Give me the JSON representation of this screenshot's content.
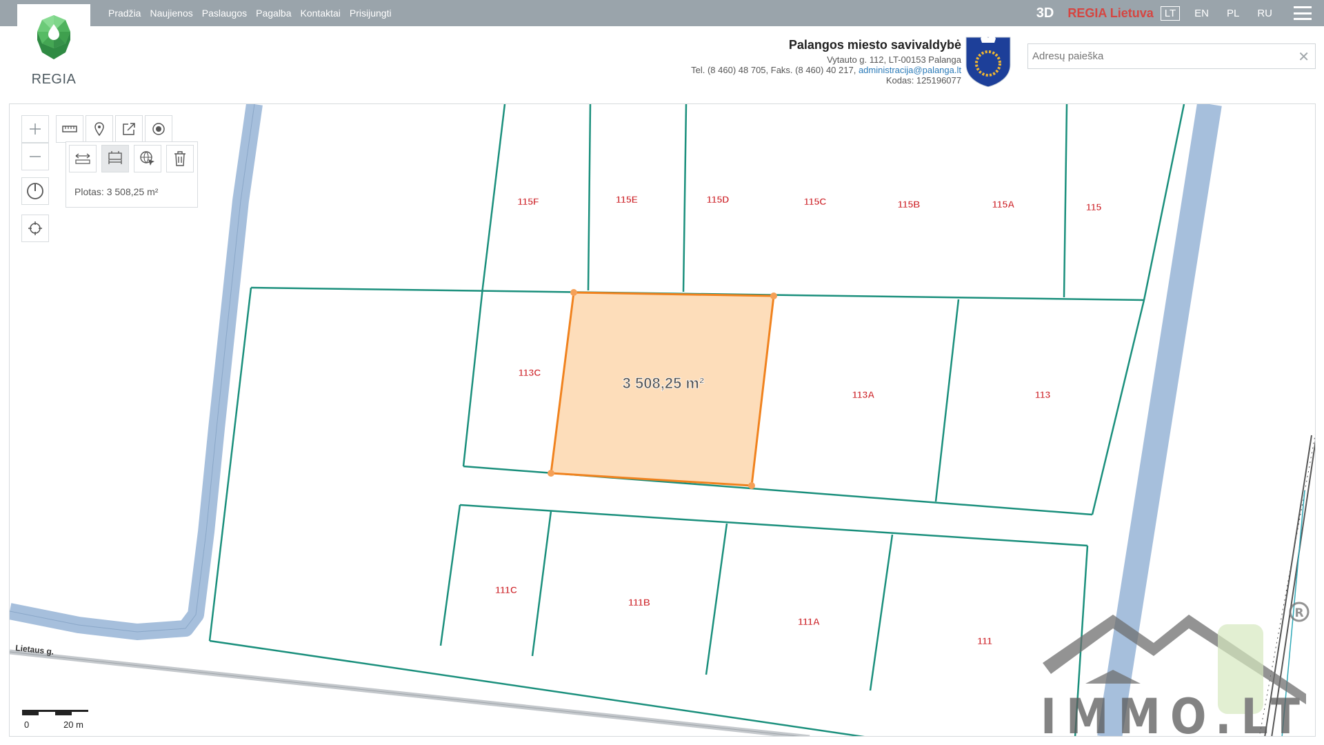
{
  "header": {
    "logo_text": "REGIA",
    "nav": [
      "Pradžia",
      "Naujienos",
      "Paslaugos",
      "Pagalba",
      "Kontaktai",
      "Prisijungti"
    ],
    "btn_3d": "3D",
    "regia_lietuva": "REGIA Lietuva",
    "languages": [
      "LT",
      "EN",
      "PL",
      "RU"
    ],
    "active_language": "LT"
  },
  "municipality": {
    "name": "Palangos miesto savivaldybė",
    "address": "Vytauto g. 112, LT-00153 Palanga",
    "phone_prefix": "Tel. (8 460) 48 705, Faks. (8 460) 40 217, ",
    "email": "administracija@palanga.lt",
    "code": "Kodas: 125196077"
  },
  "search": {
    "placeholder": "Adresų paieška",
    "clear": "✕"
  },
  "toolbar": {
    "area_info": "Plotas: 3 508,25 m²",
    "icons": [
      "zoom-in-icon",
      "zoom-out-icon",
      "ruler-icon",
      "pin-icon",
      "share-icon",
      "target-icon",
      "measure-distance-icon",
      "measure-area-icon",
      "globe-cursor-icon",
      "trash-icon",
      "compass-icon",
      "locate-icon"
    ]
  },
  "map": {
    "measured_area_label": "3 508,25 m²",
    "street_label": "Lietaus g.",
    "parcel_labels": [
      "115F",
      "115E",
      "115D",
      "115C",
      "115B",
      "115A",
      "115",
      "113C",
      "113A",
      "113",
      "111C",
      "111B",
      "111A",
      "111"
    ],
    "scale_zero": "0",
    "scale_label": "20 m",
    "watermark": "IMMO.LT",
    "watermark_mark": "R"
  },
  "colors": {
    "topbar": "#9aa4ab",
    "parcel_line": "#1a8f7c",
    "road": "#a6bfdc",
    "selection_fill": "#fdd9b3",
    "selection_stroke": "#f0821e",
    "parcel_label": "#cc1e24",
    "brand_red": "#d64541"
  }
}
